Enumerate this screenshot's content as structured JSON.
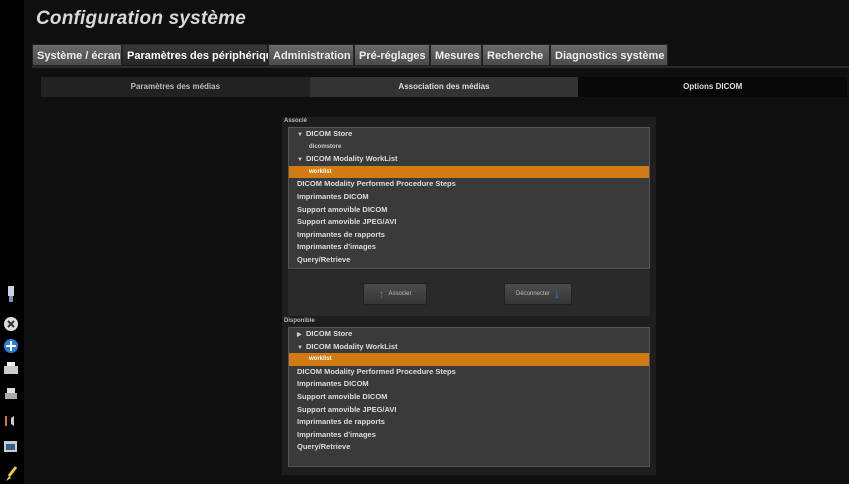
{
  "title": "Configuration système",
  "tabs": [
    {
      "label": "Système / écran",
      "active": false
    },
    {
      "label": "Paramètres des périphériques",
      "active": true
    },
    {
      "label": "Administration",
      "active": false
    },
    {
      "label": "Pré-réglages",
      "active": false
    },
    {
      "label": "Mesures",
      "active": false
    },
    {
      "label": "Recherche",
      "active": false
    },
    {
      "label": "Diagnostics système",
      "active": false
    }
  ],
  "subtabs": [
    "Paramètres des médias",
    "Association des médias",
    "Options DICOM"
  ],
  "associated": {
    "label": "Associé",
    "items": [
      {
        "label": "DICOM Store",
        "type": "parent",
        "expanded": true
      },
      {
        "label": "dicomstore",
        "type": "child"
      },
      {
        "label": "DICOM Modality WorkList",
        "type": "parent",
        "expanded": true
      },
      {
        "label": "worklist",
        "type": "child",
        "selected": true
      },
      {
        "label": "DICOM Modality Performed Procedure Steps",
        "type": "item"
      },
      {
        "label": "Imprimantes DICOM",
        "type": "item"
      },
      {
        "label": "Support amovible DICOM",
        "type": "item"
      },
      {
        "label": "Support amovible JPEG/AVI",
        "type": "item"
      },
      {
        "label": "Imprimantes de rapports",
        "type": "item"
      },
      {
        "label": "Imprimantes d'images",
        "type": "item"
      },
      {
        "label": "Query/Retrieve",
        "type": "item"
      }
    ]
  },
  "buttons": {
    "associate": "Associer",
    "disconnect": "Déconnecter"
  },
  "available": {
    "label": "Disponible",
    "items": [
      {
        "label": "DICOM Store",
        "type": "parent",
        "expanded": false
      },
      {
        "label": "DICOM Modality WorkList",
        "type": "parent",
        "expanded": true
      },
      {
        "label": "worklist",
        "type": "child",
        "selected": true
      },
      {
        "label": "DICOM Modality Performed Procedure Steps",
        "type": "item"
      },
      {
        "label": "Imprimantes DICOM",
        "type": "item"
      },
      {
        "label": "Support amovible DICOM",
        "type": "item"
      },
      {
        "label": "Support amovible JPEG/AVI",
        "type": "item"
      },
      {
        "label": "Imprimantes de rapports",
        "type": "item"
      },
      {
        "label": "Imprimantes d'images",
        "type": "item"
      },
      {
        "label": "Query/Retrieve",
        "type": "item"
      }
    ]
  },
  "rail_icons": [
    "probe-icon",
    "close-icon",
    "network-icon",
    "printer-icon",
    "print-small-icon",
    "volume-icon",
    "screenshot-icon",
    "brush-icon"
  ],
  "colors": {
    "selection": "#d27a14",
    "accent_blue": "#3a86d6"
  }
}
